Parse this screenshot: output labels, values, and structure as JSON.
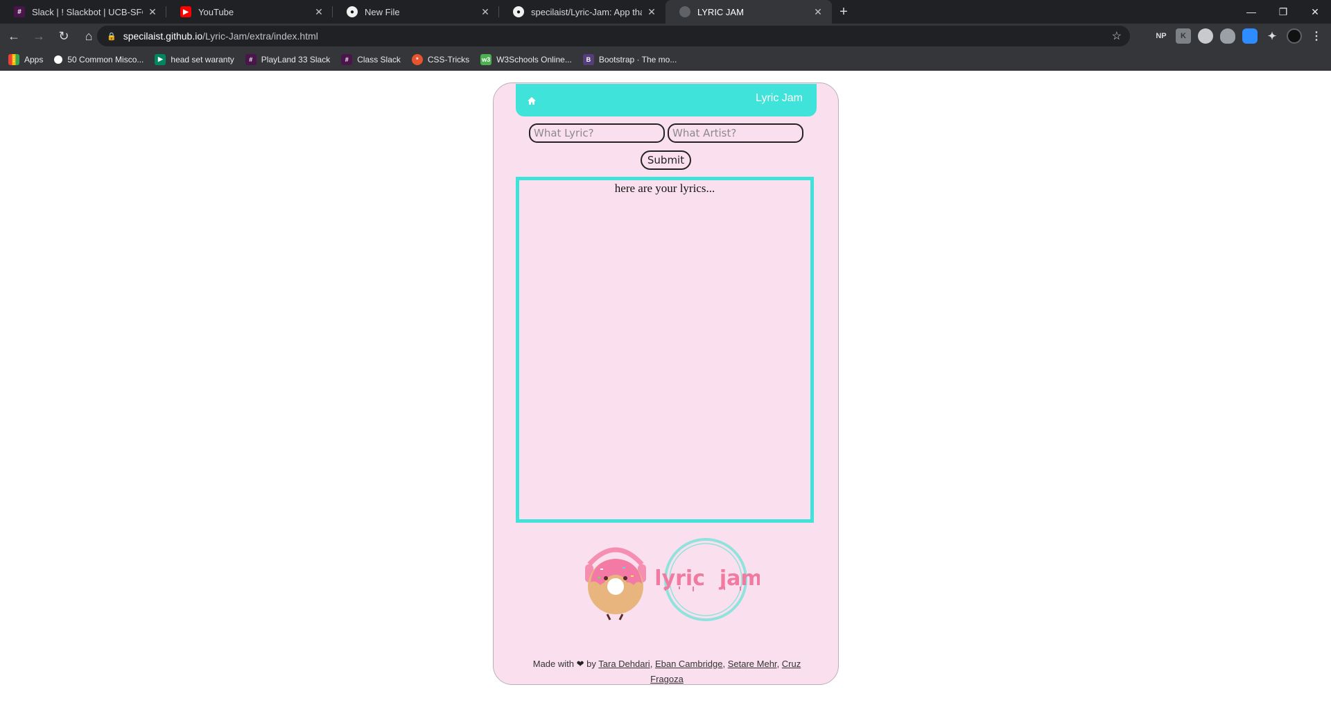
{
  "browser": {
    "tabs": [
      {
        "title": "Slack | ! Slackbot | UCB-SFC-FSF-",
        "icon": "slack-icon"
      },
      {
        "title": "YouTube",
        "icon": "youtube-icon"
      },
      {
        "title": "New File",
        "icon": "github-icon"
      },
      {
        "title": "specilaist/Lyric-Jam: App that tak",
        "icon": "github-icon"
      },
      {
        "title": "LYRIC JAM",
        "icon": "globe-icon",
        "active": true
      }
    ],
    "url_host": "specilaist.github.io",
    "url_path": "/Lyric-Jam/extra/index.html",
    "extensions": [
      "NP"
    ],
    "bookmarks": [
      {
        "label": "Apps",
        "icon": "apps-grid-icon"
      },
      {
        "label": "50 Common Misco...",
        "icon": "bookmark-dot-icon"
      },
      {
        "label": "head set waranty",
        "icon": "play-store-icon"
      },
      {
        "label": "PlayLand 33 Slack",
        "icon": "slack-icon"
      },
      {
        "label": "Class Slack",
        "icon": "slack-icon"
      },
      {
        "label": "CSS-Tricks",
        "icon": "css-tricks-icon"
      },
      {
        "label": "W3Schools Online...",
        "icon": "w3schools-icon"
      },
      {
        "label": "Bootstrap · The mo...",
        "icon": "bootstrap-icon"
      }
    ]
  },
  "app": {
    "brand": "Lyric Jam",
    "lyric_placeholder": "What Lyric?",
    "artist_placeholder": "What Artist?",
    "submit_label": "Submit",
    "lyrics_hint": "here are your lyrics...",
    "logo_text": "lyric  jam",
    "footer": {
      "prefix": "Made with",
      "heart": "❤",
      "by": "by",
      "authors": [
        "Tara Dehdari",
        "Eban Cambridge",
        "Setare Mehr",
        "Cruz Fragoza"
      ]
    }
  },
  "colors": {
    "accent": "#40e3d9",
    "card_bg": "#fae0ee",
    "logo_pink": "#f07aa0"
  }
}
